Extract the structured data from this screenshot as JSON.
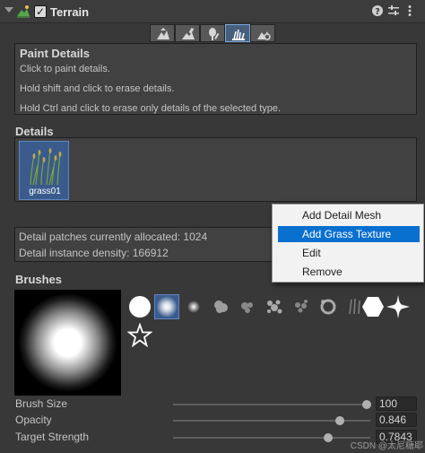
{
  "component": {
    "title": "Terrain",
    "enabled_mark": "✓",
    "icons": [
      "help-icon",
      "preset-icon",
      "kebab-menu-icon"
    ]
  },
  "toolbar": {
    "tools": [
      {
        "name": "raise-lower-icon",
        "active": false
      },
      {
        "name": "paint-texture-icon",
        "active": false
      },
      {
        "name": "paint-trees-icon",
        "active": false
      },
      {
        "name": "paint-details-icon",
        "active": true
      },
      {
        "name": "terrain-settings-icon",
        "active": false
      }
    ]
  },
  "paint_details": {
    "title": "Paint Details",
    "lines": [
      "Click to paint details.",
      "Hold shift and click to erase details.",
      "Hold Ctrl and click to erase only details of the selected type."
    ]
  },
  "details": {
    "label": "Details",
    "items": [
      {
        "name": "grass01"
      }
    ]
  },
  "stats": {
    "patches": "Detail patches currently allocated: 1024",
    "density": "Detail instance density: 166912"
  },
  "context_menu": {
    "items": [
      {
        "label": "Add Detail Mesh",
        "selected": false
      },
      {
        "label": "Add Grass Texture",
        "selected": true
      },
      {
        "label": "Edit",
        "selected": false
      },
      {
        "label": "Remove",
        "selected": false
      }
    ],
    "selected_color": "#0a70d0"
  },
  "brushes": {
    "label": "Brushes",
    "selected_index": 1
  },
  "settings": {
    "brush_size": {
      "label": "Brush Size",
      "value": "100",
      "fraction": 0.98
    },
    "opacity": {
      "label": "Opacity",
      "value": "0.846",
      "fraction": 0.846
    },
    "target_strength": {
      "label": "Target Strength",
      "value": "0.7843",
      "fraction": 0.7843
    }
  },
  "watermark": "CSDN @太尼糖耶",
  "colors": {
    "background": "#383838",
    "panel": "#414141",
    "selection": "#3a5b8c",
    "selection_border": "#5f86c0"
  }
}
